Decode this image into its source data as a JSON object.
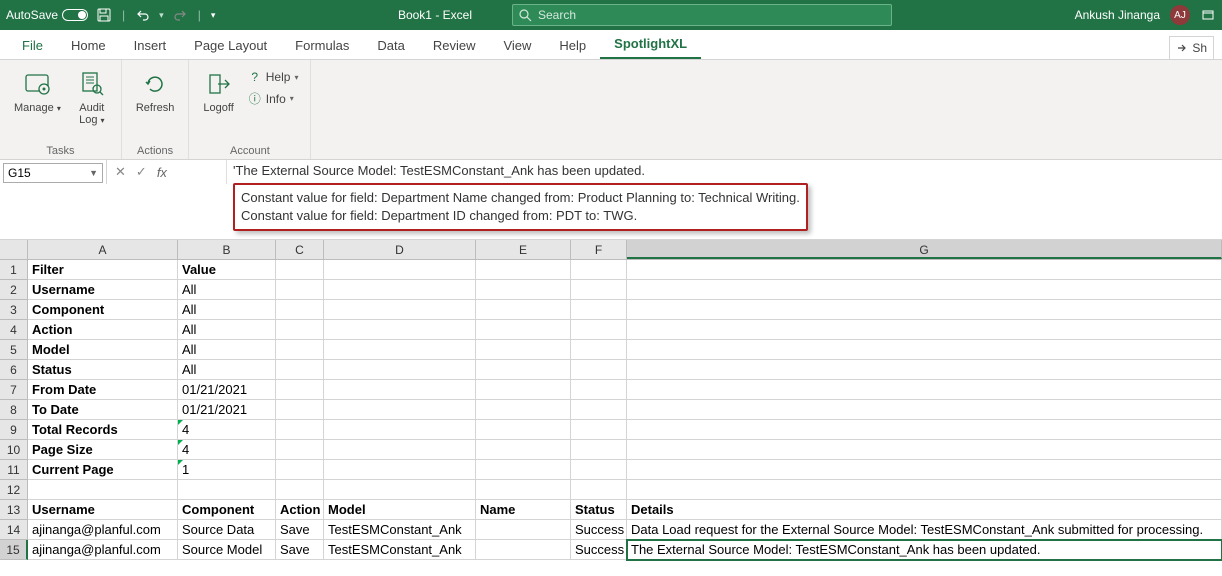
{
  "titlebar": {
    "autosave_label": "AutoSave",
    "doc_title": "Book1  -  Excel",
    "search_placeholder": "Search",
    "user_name": "Ankush Jinanga",
    "user_initials": "AJ"
  },
  "tabs": {
    "items": [
      "File",
      "Home",
      "Insert",
      "Page Layout",
      "Formulas",
      "Data",
      "Review",
      "View",
      "Help",
      "SpotlightXL"
    ],
    "active_index": 9,
    "share_label": "Sh"
  },
  "ribbon": {
    "groups": [
      {
        "label": "Tasks",
        "buttons": [
          {
            "label": "Manage",
            "dropdown": true
          },
          {
            "label": "Audit Log",
            "dropdown": true
          }
        ]
      },
      {
        "label": "Actions",
        "buttons": [
          {
            "label": "Refresh",
            "dropdown": false
          }
        ]
      },
      {
        "label": "Account",
        "buttons": [
          {
            "label": "Logoff",
            "dropdown": false
          }
        ],
        "small": [
          {
            "label": "Help",
            "dropdown": true
          },
          {
            "label": "Info",
            "dropdown": true
          }
        ]
      }
    ]
  },
  "formula_bar": {
    "cell_ref": "G15",
    "line1": "'The External Source Model: TestESMConstant_Ank has been updated.",
    "callout_line1": "Constant value for field: Department Name changed from: Product Planning to: Technical Writing.",
    "callout_line2": "Constant value for field: Department ID changed from: PDT to: TWG."
  },
  "sheet": {
    "columns": [
      "A",
      "B",
      "C",
      "D",
      "E",
      "F",
      "G"
    ],
    "selected_col": "G",
    "selected_row": 15,
    "rows": [
      {
        "n": 1,
        "A": "Filter",
        "Ab": true,
        "B": "Value",
        "Bb": true
      },
      {
        "n": 2,
        "A": "Username",
        "Ab": true,
        "B": "All"
      },
      {
        "n": 3,
        "A": "Component",
        "Ab": true,
        "B": "All"
      },
      {
        "n": 4,
        "A": "Action",
        "Ab": true,
        "B": "All"
      },
      {
        "n": 5,
        "A": "Model",
        "Ab": true,
        "B": "All"
      },
      {
        "n": 6,
        "A": "Status",
        "Ab": true,
        "B": "All"
      },
      {
        "n": 7,
        "A": "From Date",
        "Ab": true,
        "B": "01/21/2021"
      },
      {
        "n": 8,
        "A": "To Date",
        "Ab": true,
        "B": "01/21/2021"
      },
      {
        "n": 9,
        "A": "Total Records",
        "Ab": true,
        "B": "4",
        "Bgm": true
      },
      {
        "n": 10,
        "A": "Page Size",
        "Ab": true,
        "B": "4",
        "Bgm": true
      },
      {
        "n": 11,
        "A": "Current Page",
        "Ab": true,
        "B": "1",
        "Bgm": true
      },
      {
        "n": 12
      },
      {
        "n": 13,
        "A": "Username",
        "Ab": true,
        "B": "Component",
        "Bb": true,
        "C": "Action",
        "Cb": true,
        "D": "Model",
        "Db": true,
        "E": "Name",
        "Eb": true,
        "F": "Status",
        "Fb": true,
        "G": "Details",
        "Gb": true
      },
      {
        "n": 14,
        "A": "ajinanga@planful.com",
        "B": "Source Data",
        "C": "Save",
        "D": "TestESMConstant_Ank",
        "F": "Success",
        "G": "Data Load request for the External Source Model: TestESMConstant_Ank submitted for processing."
      },
      {
        "n": 15,
        "A": "ajinanga@planful.com",
        "B": "Source Model",
        "C": "Save",
        "D": "TestESMConstant_Ank",
        "F": "Success",
        "G": "The External Source Model: TestESMConstant_Ank has been updated.",
        "Gsel": true
      }
    ]
  }
}
